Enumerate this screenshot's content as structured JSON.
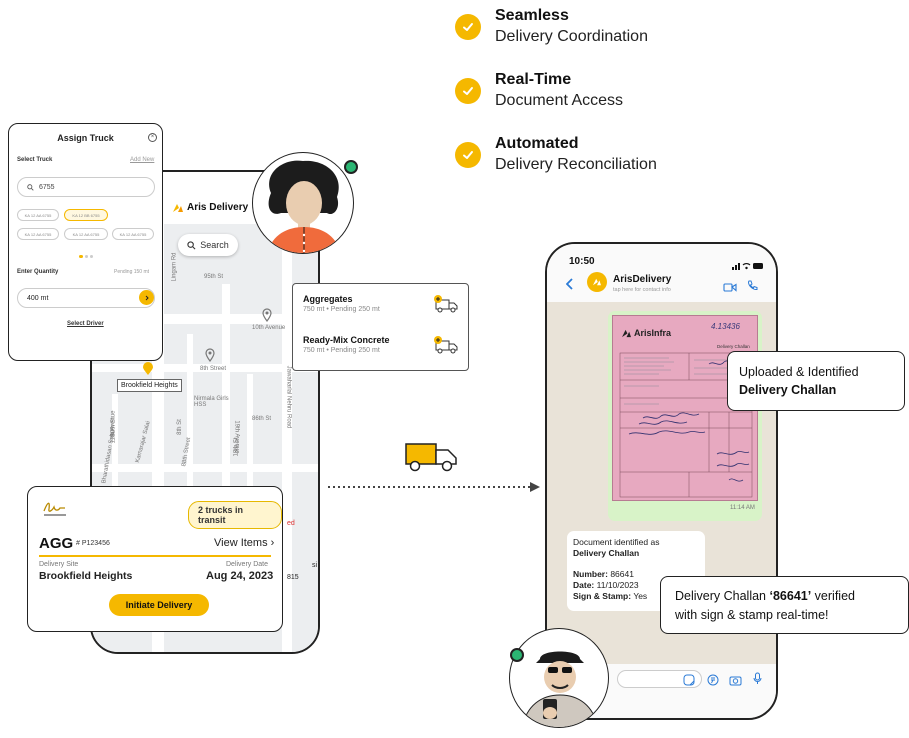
{
  "features": [
    {
      "title": "Seamless",
      "subtitle": "Delivery Coordination"
    },
    {
      "title": "Real-Time",
      "subtitle": "Document Access"
    },
    {
      "title": "Automated",
      "subtitle": "Delivery Reconciliation"
    }
  ],
  "phone1": {
    "brand": "Aris Delivery",
    "search": "Search",
    "map_labels": {
      "st95": "95th St",
      "ave10": "10th Avenue",
      "street8": "8th Street",
      "nirmala": "Nirmala Girls HSS",
      "ave19": "19th Avenue",
      "st8th": "8th St",
      "st86": "86th St",
      "jawaharlal": "Jawaharlal Nehru Road",
      "kamarajar": "Kamarajar Salai",
      "bharathidasan": "Bharathidasan Salai",
      "lingam": "Lingam Rd",
      "st88": "88th Street",
      "ave11": "11th Avenue",
      "st80": "80th St",
      "st18": "18th St",
      "partial_ed": "ed",
      "partial_815": "815",
      "partial_si": "si"
    },
    "pin_label": "Brookfield Heights"
  },
  "assign_truck": {
    "title": "Assign Truck",
    "close_icon": "close-icon",
    "select_truck": "Select Truck",
    "add_new": "Add New",
    "search_value": "6755",
    "chips": [
      "KA 12 AA 6755",
      "KA 12 BB 6755",
      "KA 12 AA 6755",
      "KA 12 AA 6755",
      "KA 12 AA 6755",
      "KA 12 AA 6755"
    ],
    "enter_quantity": "Enter Quantity",
    "pending": "Pending 150 mt",
    "quantity": "400 mt",
    "select_driver": "Select Driver"
  },
  "materials": [
    {
      "name": "Aggregates",
      "qty": "750 mt",
      "pending": "Pending 250 mt"
    },
    {
      "name": "Ready-Mix Concrete",
      "qty": "750 mt",
      "pending": "Pending 250 mt"
    }
  ],
  "delivery_card": {
    "in_transit": "2 trucks in transit",
    "code": "AGG",
    "po": "# P123456",
    "view_items": "View Items",
    "site_label": "Delivery Site",
    "site": "Brookfield Heights",
    "date_label": "Delivery Date",
    "date": "Aug 24, 2023",
    "cta": "Initiate Delivery"
  },
  "phone2": {
    "time": "10:50",
    "contact": "ArisDelivery",
    "contact_sub": "tap here for contact info",
    "challan_brand": "ArisInfra",
    "challan_title": "Delivery Challan",
    "challan_handwritten": "4.13436",
    "photo_time": "11:14 AM",
    "doc_identified": "Document identified as",
    "doc_type": "Delivery Challan",
    "number_label": "Number:",
    "number": "86641",
    "date_label": "Date:",
    "date": "11/10/2023",
    "sign_label": "Sign & Stamp:",
    "sign": "Yes"
  },
  "callouts": {
    "uploaded_line1": "Uploaded & Identified",
    "uploaded_line2": "Delivery Challan",
    "verified_pre": "Delivery Challan ",
    "verified_num": "‘86641’",
    "verified_post": " verified",
    "verified_line2": "with sign & stamp real-time!"
  },
  "colors": {
    "accent": "#f5b800",
    "online": "#2bb673",
    "challan": "#e7a9c0",
    "map": "#eceef0"
  }
}
